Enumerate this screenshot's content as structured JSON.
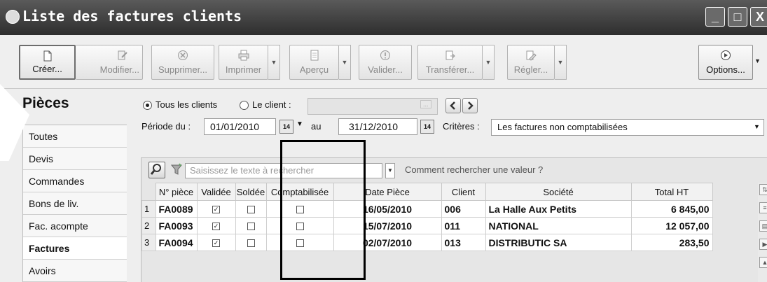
{
  "window": {
    "title": "Liste des factures clients",
    "controls": [
      "_",
      "□",
      "X"
    ]
  },
  "toolbar": {
    "buttons": [
      {
        "label": "Créer...",
        "icon": "new-document-icon",
        "enabled": true
      },
      {
        "label": "Modifier...",
        "icon": "edit-icon",
        "enabled": false
      },
      {
        "label": "Supprimer...",
        "icon": "delete-icon",
        "enabled": false
      },
      {
        "label": "Imprimer",
        "icon": "print-icon",
        "enabled": false
      },
      {
        "label": "Aperçu",
        "icon": "preview-icon",
        "enabled": false
      },
      {
        "label": "Valider...",
        "icon": "validate-icon",
        "enabled": false
      },
      {
        "label": "Transférer...",
        "icon": "transfer-icon",
        "enabled": false
      },
      {
        "label": "Régler...",
        "icon": "pay-icon",
        "enabled": false
      },
      {
        "label": "Options...",
        "icon": "options-icon",
        "enabled": true
      }
    ]
  },
  "nav": {
    "title": "Pièces",
    "items": [
      "Toutes",
      "Devis",
      "Commandes",
      "Bons de liv.",
      "Fac. acompte",
      "Factures",
      "Avoirs"
    ],
    "selected": "Factures"
  },
  "filters": {
    "all_clients": "Tous les clients",
    "one_client": "Le client :",
    "period_label": "Période du :",
    "date_from": "01/01/2010",
    "to_label": "au",
    "date_to": "31/12/2010",
    "criteria_label": "Critères :",
    "criteria_value": "Les factures non comptabilisées",
    "client_btn": "...",
    "calendar_day": "14"
  },
  "search": {
    "placeholder": "Saisissez le texte à rechercher",
    "help_link": "Comment rechercher une valeur ?"
  },
  "table": {
    "columns": [
      "N° pièce",
      "Validée",
      "Soldée",
      "Comptabilisée",
      "Date Pièce",
      "Client",
      "Société",
      "Total HT"
    ],
    "rows": [
      {
        "n": "1",
        "piece": "FA0089",
        "validee": true,
        "soldee": false,
        "compta": false,
        "date": "16/05/2010",
        "client": "006",
        "societe": "La Halle Aux Petits",
        "total": "6 845,00"
      },
      {
        "n": "2",
        "piece": "FA0093",
        "validee": true,
        "soldee": false,
        "compta": false,
        "date": "15/07/2010",
        "client": "011",
        "societe": "NATIONAL",
        "total": "12 057,00"
      },
      {
        "n": "3",
        "piece": "FA0094",
        "validee": true,
        "soldee": false,
        "compta": false,
        "date": "02/07/2010",
        "client": "013",
        "societe": "DISTRIBUTIC SA",
        "total": "283,50"
      }
    ]
  }
}
